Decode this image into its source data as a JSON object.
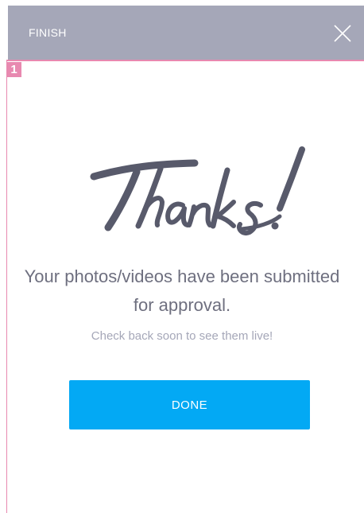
{
  "header": {
    "title": "FINISH",
    "close_icon": "close-icon"
  },
  "step": {
    "number": "1"
  },
  "main": {
    "thanks_text": "Thanks!",
    "message": "Your photos/videos have been submitted for approval.",
    "sub_message": "Check back soon to see them live!",
    "done_label": "DONE"
  },
  "colors": {
    "header_bg": "#a5a7b8",
    "accent_pink": "#e889b0",
    "button_blue": "#03a9f4",
    "text_gray": "#6e6f7f"
  }
}
